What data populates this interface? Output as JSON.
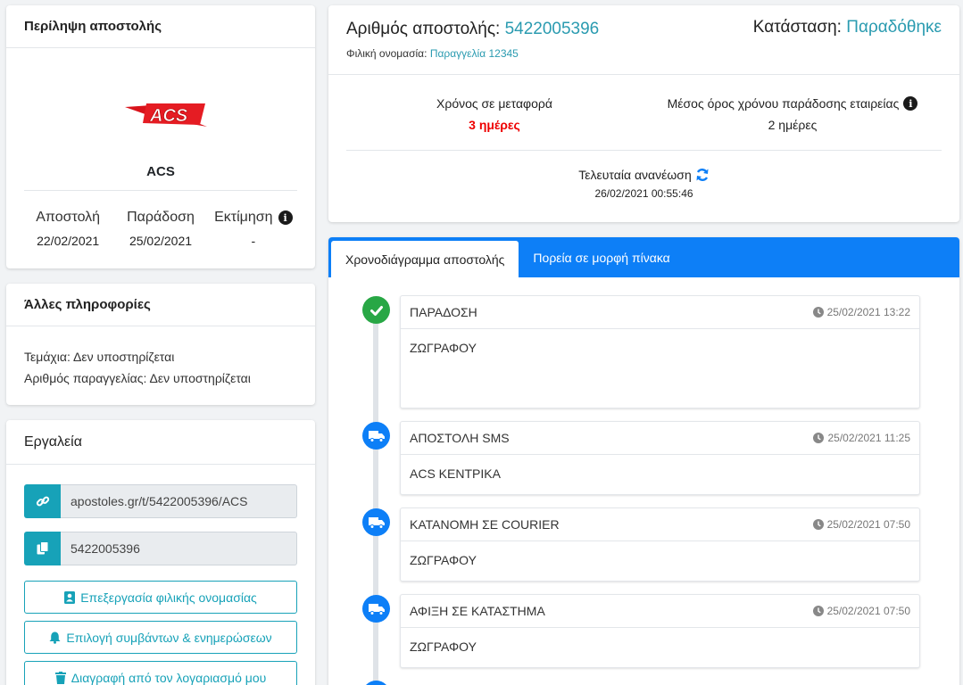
{
  "summary": {
    "title": "Περίληψη αποστολής",
    "carrier_name": "ACS",
    "logo_text": "ACS",
    "dates": [
      {
        "label": "Αποστολή",
        "value": "22/02/2021"
      },
      {
        "label": "Παράδοση",
        "value": "25/02/2021"
      },
      {
        "label": "Εκτίμηση",
        "value": "-"
      }
    ]
  },
  "other": {
    "title": "Άλλες πληροφορίες",
    "pieces": "Τεμάχια: Δεν υποστηρίζεται",
    "order_number": "Αριθμός παραγγελίας: Δεν υποστηρίζεται"
  },
  "tools": {
    "title": "Εργαλεία",
    "link_value": "apostoles.gr/t/5422005396/ACS",
    "copy_value": "5422005396",
    "edit_label": "Επεξεργασία φιλικής ονομασίας",
    "events_label": "Επιλογή συμβάντων & ενημερώσεων",
    "delete_label": "Διαγραφή από τον λογαριασμό μου"
  },
  "header": {
    "ship_label": "Αριθμός αποστολής:",
    "ship_number": "5422005396",
    "friendly_label": "Φιλική ονομασία:",
    "friendly_value": "Παραγγελία 12345",
    "status_label": "Κατάσταση:",
    "status_value": "Παραδόθηκε",
    "transit_label": "Χρόνος σε μεταφορά",
    "transit_value": "3 ημέρες",
    "avg_label": "Μέσος όρος χρόνου παράδοσης εταιρείας",
    "avg_value": "2 ημέρες",
    "refresh_label": "Τελευταία ανανέωση",
    "refresh_time": "26/02/2021 00:55:46"
  },
  "tabs": {
    "timeline": "Χρονοδιάγραμμα αποστολής",
    "table": "Πορεία σε μορφή πίνακα"
  },
  "events": [
    {
      "title": "ΠΑΡΑΔΟΣΗ",
      "date": "25/02/2021 13:22",
      "location": "ΖΩΓΡΑΦΟΥ",
      "icon": "check-icon"
    },
    {
      "title": "ΑΠΟΣΤΟΛΗ SMS",
      "date": "25/02/2021 11:25",
      "location": "ACS ΚΕΝΤΡΙΚΑ",
      "icon": "truck-icon"
    },
    {
      "title": "ΚΑΤΑΝΟΜΗ ΣΕ COURIER",
      "date": "25/02/2021 07:50",
      "location": "ΖΩΓΡΑΦΟΥ",
      "icon": "truck-icon"
    },
    {
      "title": "ΑΦΙΞΗ ΣΕ ΚΑΤΑΣΤΗΜΑ",
      "date": "25/02/2021 07:50",
      "location": "ΖΩΓΡΑΦΟΥ",
      "icon": "truck-icon"
    }
  ]
}
